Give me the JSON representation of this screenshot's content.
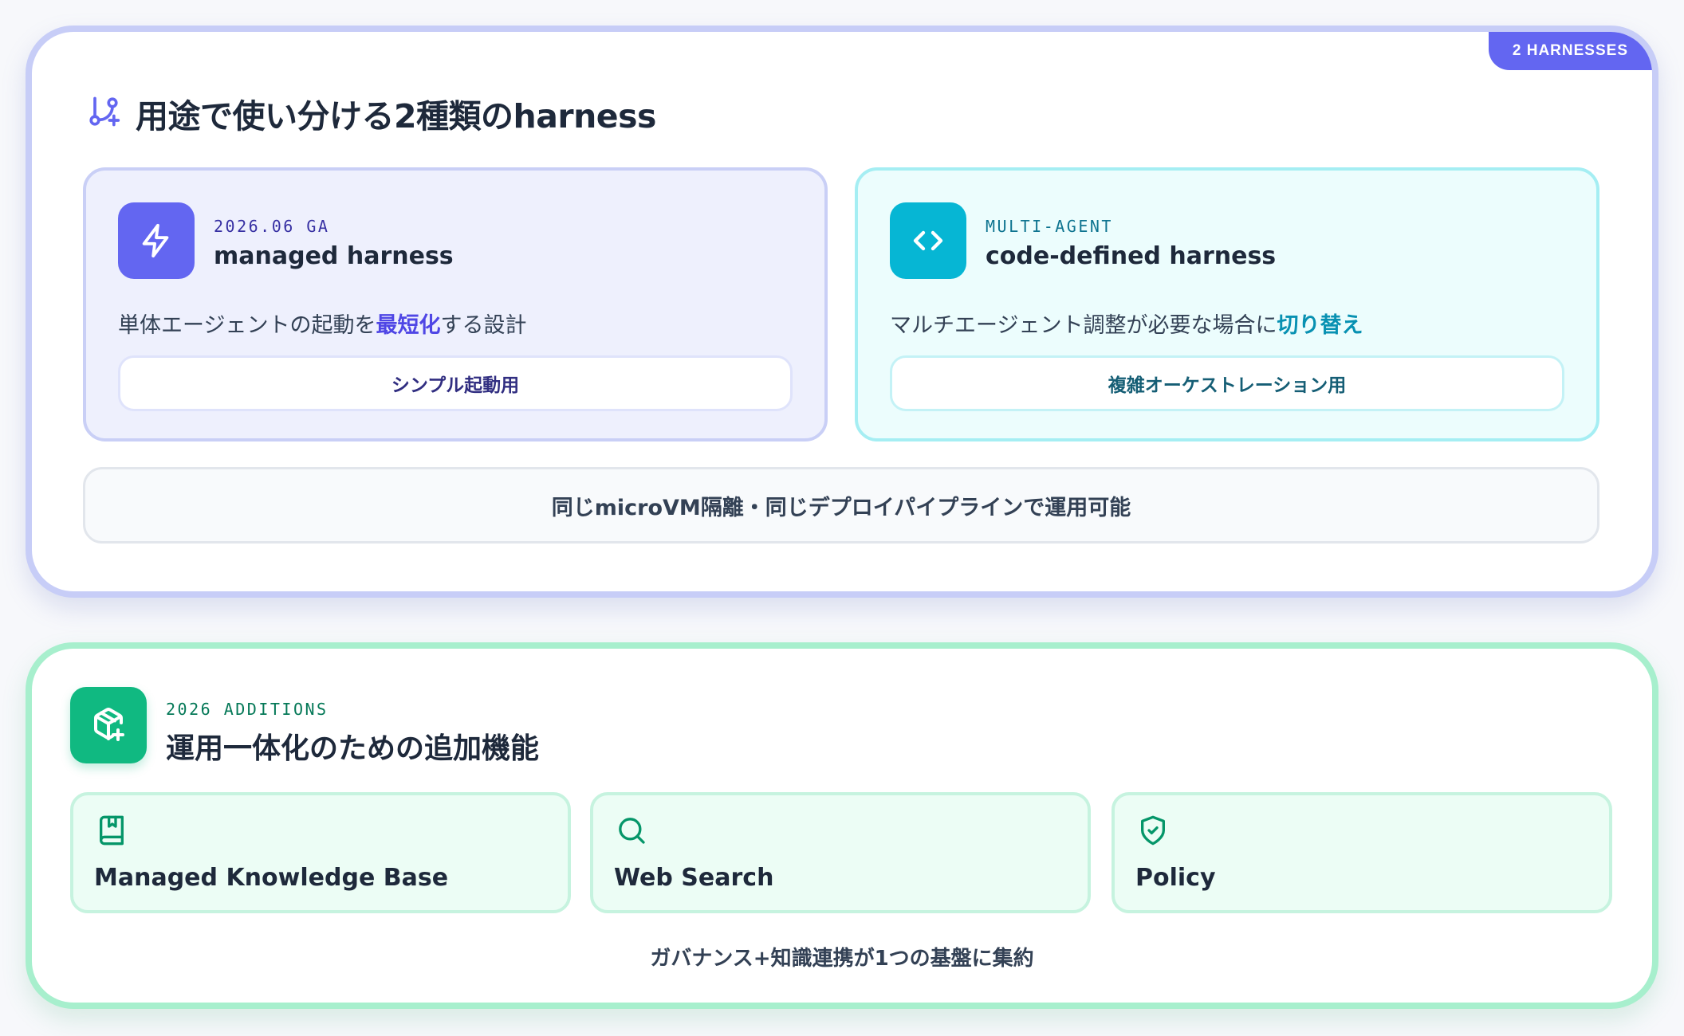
{
  "harness_panel": {
    "badge": "2 HARNESSES",
    "title": "用途で使い分ける2種類のharness",
    "cards": [
      {
        "eyebrow": "2026.06 GA",
        "name": "managed harness",
        "desc_before": "単体エージェントの起動を",
        "desc_highlight": "最短化",
        "desc_after": "する設計",
        "pill": "シンプル起動用",
        "icon": "lightning-icon",
        "accent": "#6366f1"
      },
      {
        "eyebrow": "MULTI-AGENT",
        "name": "code-defined harness",
        "desc_before": "マルチエージェント調整が必要な場合に",
        "desc_highlight": "切り替え",
        "desc_after": "",
        "pill": "複雑オーケストレーション用",
        "icon": "code-brackets-icon",
        "accent": "#06b6d4"
      }
    ],
    "shared_note": "同じmicroVM隔離・同じデプロイパイプラインで運用可能"
  },
  "additions_panel": {
    "eyebrow": "2026 ADDITIONS",
    "title": "運用一体化のための追加機能",
    "icon": "package-plus-icon",
    "accent": "#10b981",
    "features": [
      {
        "label": "Managed Knowledge Base",
        "icon": "book-bookmark-icon"
      },
      {
        "label": "Web Search",
        "icon": "search-icon"
      },
      {
        "label": "Policy",
        "icon": "shield-check-icon"
      }
    ],
    "footer": "ガバナンス+知識連携が1つの基盤に集約"
  }
}
